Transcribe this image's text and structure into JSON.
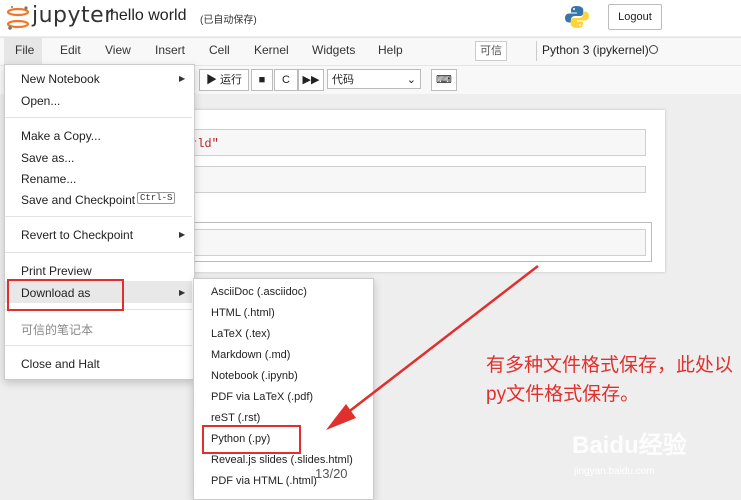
{
  "header": {
    "logo_text": "jupyter",
    "notebook_name": "hello world",
    "autosave_status": "(已自动保存)",
    "logout_label": "Logout"
  },
  "menubar": {
    "items": [
      "File",
      "Edit",
      "View",
      "Insert",
      "Cell",
      "Kernel",
      "Widgets",
      "Help"
    ],
    "trusted_label": "可信",
    "kernel_name": "Python 3 (ipykernel)"
  },
  "toolbar": {
    "run_label": "▶ 运行",
    "stop_label": "■",
    "restart_label": "C",
    "fast_forward_label": "▶▶",
    "cell_type_value": "代码",
    "keyboard_label": "⌨"
  },
  "notebook": {
    "visible_code_fragment": "rld\""
  },
  "file_menu": {
    "new_notebook": "New Notebook",
    "open": "Open...",
    "make_copy": "Make a Copy...",
    "save_as": "Save as...",
    "rename": "Rename...",
    "save_checkpoint": "Save and Checkpoint",
    "save_checkpoint_shortcut": "Ctrl-S",
    "revert_checkpoint": "Revert to Checkpoint",
    "print_preview": "Print Preview",
    "download_as": "Download as",
    "trusted_notebook": "可信的笔记本",
    "close_halt": "Close and Halt"
  },
  "download_submenu": [
    "AsciiDoc (.asciidoc)",
    "HTML (.html)",
    "LaTeX (.tex)",
    "Markdown (.md)",
    "Notebook (.ipynb)",
    "PDF via LaTeX (.pdf)",
    "reST (.rst)",
    "Python (.py)",
    "Reveal.js slides (.slides.html)",
    "PDF via HTML (.html)"
  ],
  "annotation": {
    "text": "有多种文件格式保存，此处以py文件格式保存。",
    "color": "#e0302e"
  },
  "page_counter": "13/20",
  "watermark": {
    "brand": "Baidu经验",
    "url": "jingyan.baidu.com"
  },
  "colors": {
    "jupyter_orange": "#f37626",
    "annotation_red": "#e0302e"
  }
}
